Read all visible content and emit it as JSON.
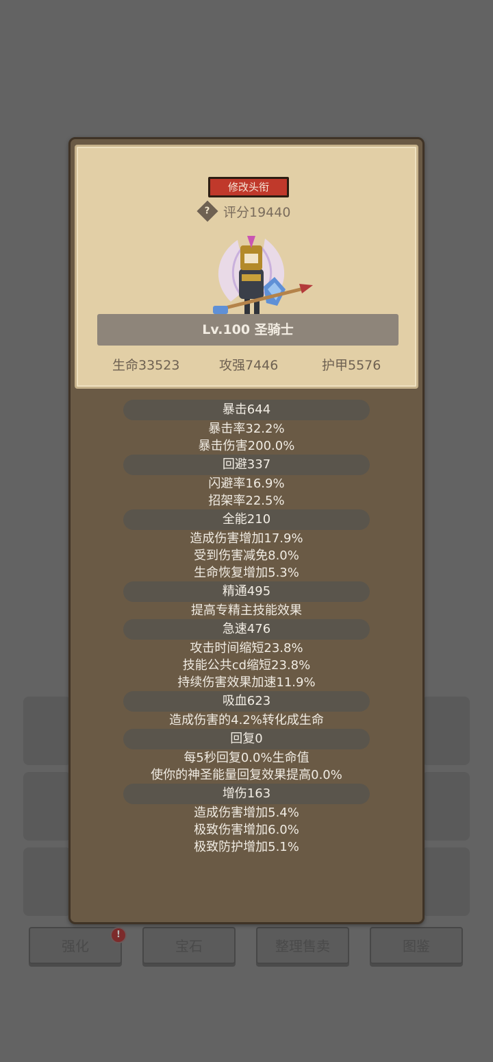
{
  "profile": {
    "rename_label": "修改头衔",
    "score_label": "评分19440",
    "help_icon": "?",
    "level_label": "Lv.100 圣骑士",
    "stats": [
      {
        "label": "生命33523"
      },
      {
        "label": "攻强7446"
      },
      {
        "label": "护甲5576"
      }
    ]
  },
  "attributes": [
    {
      "title": "暴击644",
      "details": [
        "暴击率32.2%",
        "暴击伤害200.0%"
      ]
    },
    {
      "title": "回避337",
      "details": [
        "闪避率16.9%",
        "招架率22.5%"
      ]
    },
    {
      "title": "全能210",
      "details": [
        "造成伤害增加17.9%",
        "受到伤害减免8.0%",
        "生命恢复增加5.3%"
      ]
    },
    {
      "title": "精通495",
      "details": [
        "提高专精主技能效果"
      ]
    },
    {
      "title": "急速476",
      "details": [
        "攻击时间缩短23.8%",
        "技能公共cd缩短23.8%",
        "持续伤害效果加速11.9%"
      ]
    },
    {
      "title": "吸血623",
      "details": [
        "造成伤害的4.2%转化成生命"
      ]
    },
    {
      "title": "回复0",
      "details": [
        "每5秒回复0.0%生命值",
        "使你的神圣能量回复效果提高0.0%"
      ]
    },
    {
      "title": "增伤163",
      "details": [
        "造成伤害增加5.4%",
        "极致伤害增加6.0%",
        "极致防护增加5.1%"
      ]
    }
  ],
  "bottom_nav": {
    "items": [
      {
        "label": "强化"
      },
      {
        "label": "宝石"
      },
      {
        "label": "整理售卖"
      },
      {
        "label": "图鉴"
      }
    ],
    "alert_badge": "!"
  },
  "colors": {
    "rename_button": "#c0392b",
    "panel": "#6a5a45",
    "card": "#e2cfa6"
  }
}
